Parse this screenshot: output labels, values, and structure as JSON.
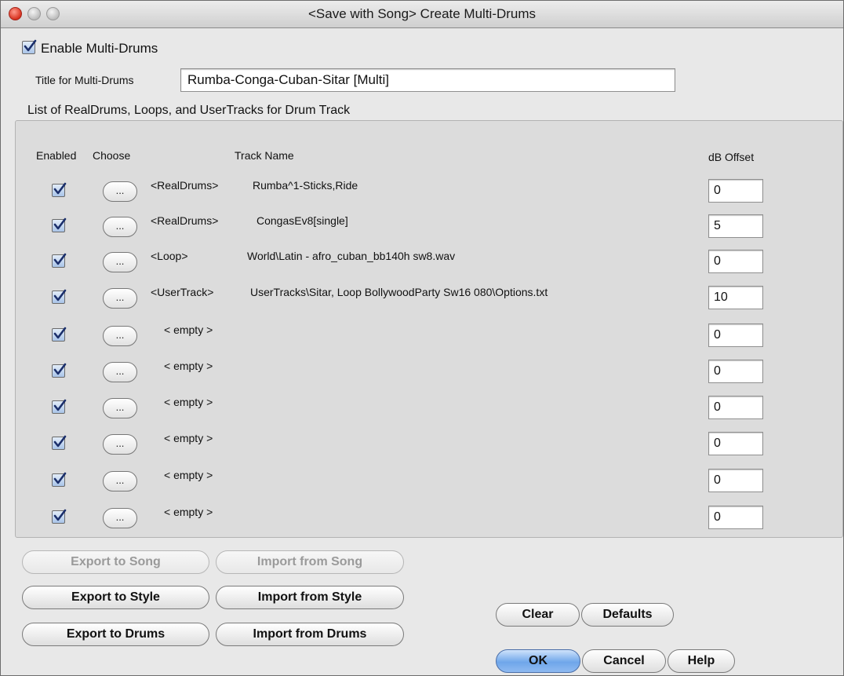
{
  "window": {
    "title": "<Save with Song> Create Multi-Drums"
  },
  "enable": {
    "label": "Enable Multi-Drums",
    "checked": true
  },
  "title_field": {
    "label": "Title for Multi-Drums",
    "value": "Rumba-Conga-Cuban-Sitar [Multi]"
  },
  "list": {
    "heading": "List of RealDrums, Loops, and UserTracks for Drum Track",
    "columns": {
      "enabled": "Enabled",
      "choose": "Choose",
      "track_name": "Track Name",
      "db_offset": "dB Offset"
    },
    "choose_label": "...",
    "rows": [
      {
        "enabled": true,
        "type": "<RealDrums>",
        "name": "Rumba^1-Sticks,Ride",
        "db": "0"
      },
      {
        "enabled": true,
        "type": "<RealDrums>",
        "name": "CongasEv8[single]",
        "db": "5"
      },
      {
        "enabled": true,
        "type": "<Loop>",
        "name": "World\\Latin - afro_cuban_bb140h sw8.wav",
        "db": "0"
      },
      {
        "enabled": true,
        "type": "<UserTrack>",
        "name": "UserTracks\\Sitar, Loop BollywoodParty Sw16 080\\Options.txt",
        "db": "10"
      },
      {
        "enabled": true,
        "type": "< empty >",
        "name": "",
        "db": "0"
      },
      {
        "enabled": true,
        "type": "< empty >",
        "name": "",
        "db": "0"
      },
      {
        "enabled": true,
        "type": "< empty >",
        "name": "",
        "db": "0"
      },
      {
        "enabled": true,
        "type": "< empty >",
        "name": "",
        "db": "0"
      },
      {
        "enabled": true,
        "type": "< empty >",
        "name": "",
        "db": "0"
      },
      {
        "enabled": true,
        "type": "< empty >",
        "name": "",
        "db": "0"
      }
    ]
  },
  "buttons": {
    "export_song": "Export to Song",
    "import_song": "Import from Song",
    "export_style": "Export to Style",
    "import_style": "Import from Style",
    "export_drums": "Export to Drums",
    "import_drums": "Import from Drums",
    "clear": "Clear",
    "defaults": "Defaults",
    "ok": "OK",
    "cancel": "Cancel",
    "help": "Help"
  }
}
